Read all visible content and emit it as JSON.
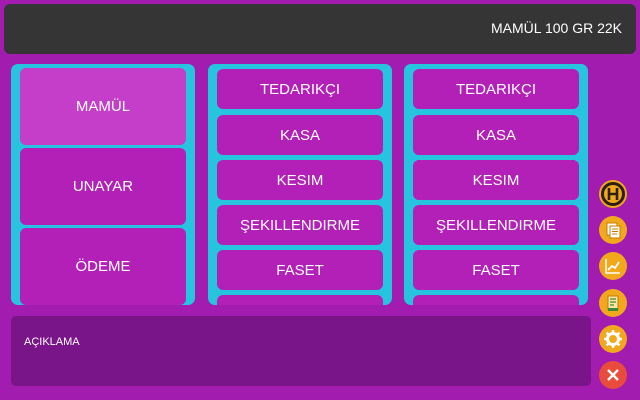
{
  "header": {
    "title": "MAMÜL 100 GR 22K"
  },
  "categories": [
    {
      "label": "MAMÜL",
      "selected": true
    },
    {
      "label": "UNAYAR",
      "selected": false
    },
    {
      "label": "ÖDEME",
      "selected": false
    }
  ],
  "middle_options": [
    "TEDARIKÇI",
    "KASA",
    "KESIM",
    "ŞEKILLENDIRME",
    "FASET"
  ],
  "right_options": [
    "TEDARIKÇI",
    "KASA",
    "KESIM",
    "ŞEKILLENDIRME",
    "FASET"
  ],
  "description": {
    "label": "AÇIKLAMA"
  },
  "side_icons": [
    {
      "icon": "h-icon",
      "color": "#f2a81d"
    },
    {
      "icon": "documents-icon",
      "color": "#f2a81d"
    },
    {
      "icon": "chart-icon",
      "color": "#f2a81d"
    },
    {
      "icon": "receipt-icon",
      "color": "#f2a81d"
    },
    {
      "icon": "gear-icon",
      "color": "#f2a81d"
    },
    {
      "icon": "close-icon",
      "color": "#e94c3c"
    }
  ],
  "colors": {
    "background": "#a21caf",
    "header": "#353535",
    "panel": "#27c4e0",
    "button": "#b220b8",
    "button_selected": "#c43ec9",
    "description": "#7a1489"
  }
}
